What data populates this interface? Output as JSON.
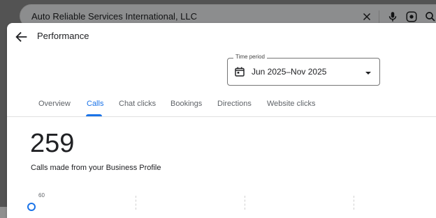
{
  "search": {
    "query": "Auto Reliable Services International, LLC",
    "clear_icon": "close-icon",
    "mic_icon": "mic-icon",
    "lens_icon": "lens-icon",
    "search_icon": "search-icon"
  },
  "header": {
    "title": "Performance",
    "back_icon": "arrow-back-icon"
  },
  "time_period": {
    "label": "Time period",
    "value": "Jun 2025–Nov 2025",
    "icon": "calendar-icon"
  },
  "tabs": [
    {
      "label": "Overview",
      "active": false
    },
    {
      "label": "Calls",
      "active": true
    },
    {
      "label": "Chat clicks",
      "active": false
    },
    {
      "label": "Bookings",
      "active": false
    },
    {
      "label": "Directions",
      "active": false
    },
    {
      "label": "Website clicks",
      "active": false
    }
  ],
  "metric": {
    "value": "259",
    "caption": "Calls made from your Business Profile"
  },
  "chart": {
    "y_tick_top": "60"
  },
  "colors": {
    "accent": "#1a73e8"
  }
}
